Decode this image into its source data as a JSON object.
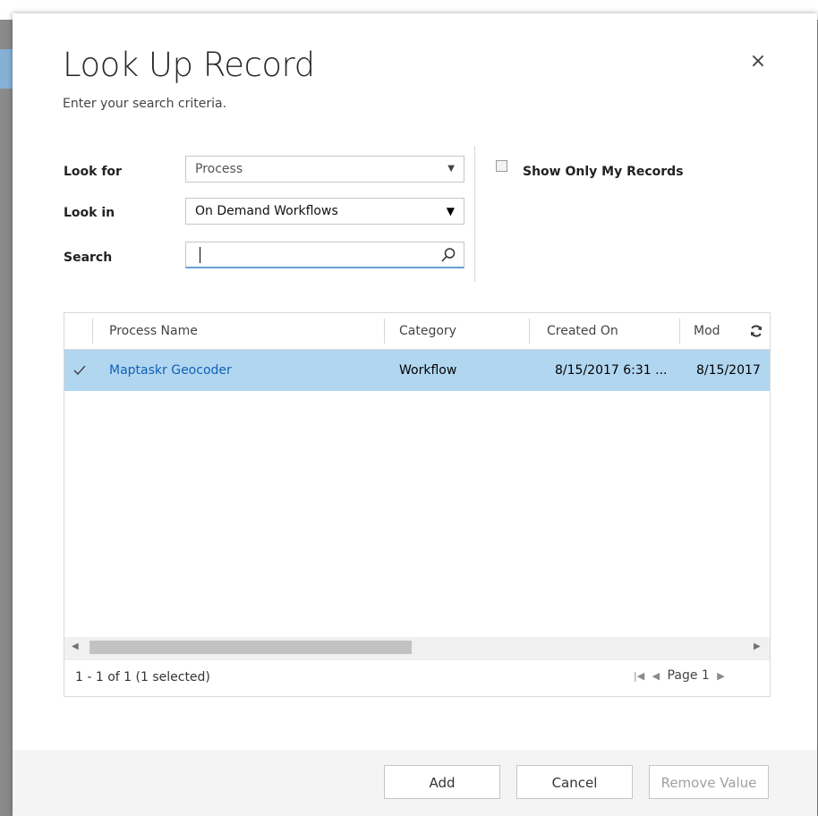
{
  "dialog": {
    "title": "Look Up Record",
    "subtitle": "Enter your search criteria.",
    "close_label": "×"
  },
  "criteria": {
    "look_for_label": "Look for",
    "look_for_value": "Process",
    "look_in_label": "Look in",
    "look_in_value": "On Demand Workflows",
    "search_label": "Search",
    "search_value": "",
    "show_only_mine_label": "Show Only My Records"
  },
  "grid": {
    "columns": [
      "Process Name",
      "Category",
      "Created On",
      "Mod"
    ],
    "rows": [
      {
        "process_name": "Maptaskr Geocoder",
        "category": "Workflow",
        "created_on": "8/15/2017 6:31 ...",
        "modified_on": "8/15/2017"
      }
    ],
    "record_count": "1 - 1 of 1 (1 selected)",
    "page_label": "Page 1"
  },
  "buttons": {
    "add": "Add",
    "cancel": "Cancel",
    "remove_value": "Remove Value"
  },
  "colors": {
    "selected_row": "#b1d6f0",
    "link": "#1160b7"
  }
}
